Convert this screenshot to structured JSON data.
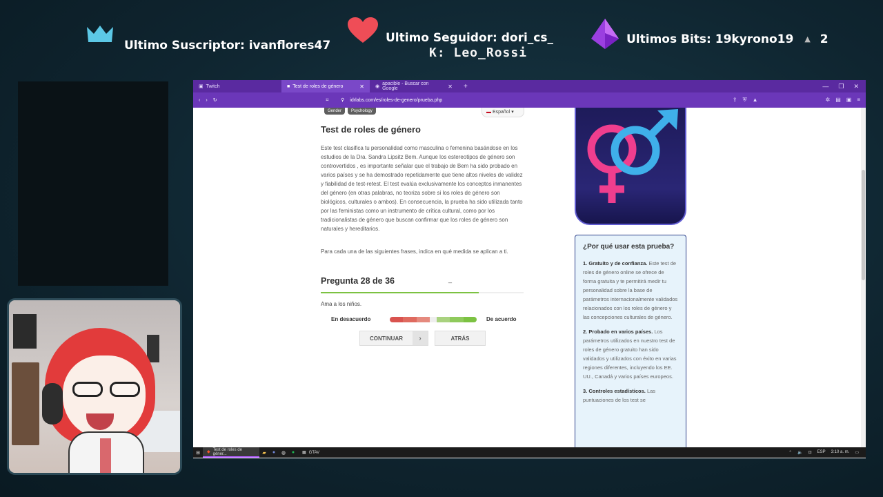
{
  "overlay": {
    "subscriber": "Ultimo Suscriptor: ivanflores47",
    "follower": "Ultimo Seguidor: dori_cs_",
    "bits": "Ultimos Bits: 19kyrono19",
    "bits_count": "2",
    "mod": "K: Leo_Rossi"
  },
  "browser": {
    "tabs": [
      {
        "label": "Twitch"
      },
      {
        "label": "Test de roles de género"
      },
      {
        "label": "apacible - Buscar con Google"
      }
    ],
    "url": "idrlabs.com/es/roles-de-genero/prueba.php"
  },
  "page": {
    "tags": [
      "Gender",
      "Psychology"
    ],
    "language": "Español",
    "title": "Test de roles de género",
    "description": "Este test clasifica tu personalidad como masculina o femenina basándose en los estudios de la Dra. Sandra Lipsitz Bem. Aunque los estereotipos de género son controvertidos , es importante señalar que el trabajo de Bem ha sido probado en varios países y se ha demostrado repetidamente que tiene altos niveles de validez y fiabilidad de test-retest. El test evalúa exclusivamente los conceptos inmanentes del género (en otras palabras, no teoriza sobre si los roles de género son biológicos, culturales o ambos). En consecuencia, la prueba ha sido utilizada tanto por las feministas como un instrumento de crítica cultural, como por los tradicionalistas de género que buscan confirmar que los roles de género son naturales y hereditarios.",
    "instruction": "Para cada una de las siguientes frases, indica en qué medida se aplican a ti.",
    "question_label": "Pregunta 28 de 36",
    "question_dash": "_",
    "progress": 0.78,
    "question_text": "Ama a los niños.",
    "scale_left": "En desacuerdo",
    "scale_right": "De acuerdo",
    "continue": "CONTINUAR",
    "back": "ATRÁS",
    "info_title": "¿Por qué usar esta prueba?",
    "info_items": [
      {
        "head": "1. Gratuito y de confianza.",
        "body": " Este test de roles de género online se ofrece de forma gratuita y te permitirá medir tu personalidad sobre la base de parámetros internacionalmente validados relacionados con los roles de género y las concepciones culturales de género."
      },
      {
        "head": "2. Probado en varios países.",
        "body": " Los parámetros utilizados en nuestro test de roles de género gratuito han sido validados y utilizados con éxito en varias regiones diferentes, incluyendo los EE. UU., Canadá y varios países europeos."
      },
      {
        "head": "3. Controles estadísticos.",
        "body": " Las puntuaciones de los test se"
      }
    ]
  },
  "taskbar": {
    "active_item": "Test de roles de géner...",
    "gta": "GTAV",
    "lang": "ESP",
    "time": "3:10 a. m."
  },
  "colors": {
    "accent_purple": "#6b37b9",
    "twitch_bg": "#0f2530",
    "progress_green": "#7cc242",
    "scale_red": "#d9534f"
  }
}
